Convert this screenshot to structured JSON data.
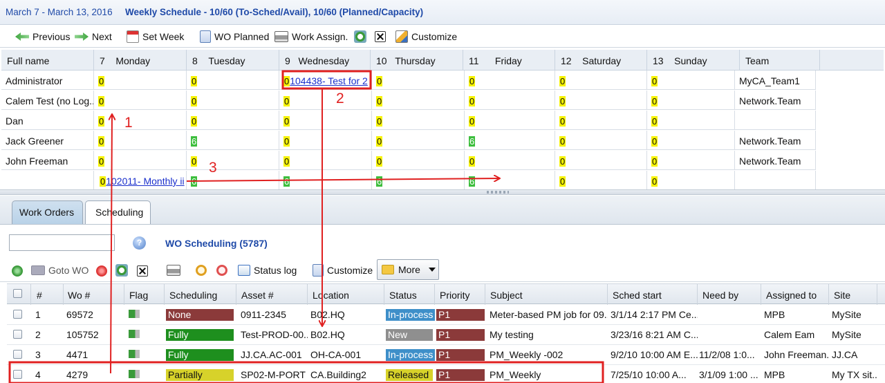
{
  "header": {
    "date_range": "March 7 - March 13, 2016",
    "title": "Weekly Schedule - 10/60 (To-Sched/Avail), 10/60 (Planned/Capacity)"
  },
  "toolbar1": {
    "previous": "Previous",
    "next": "Next",
    "set_week": "Set Week",
    "wo_planned": "WO Planned",
    "work_assign": "Work Assign.",
    "customize": "Customize"
  },
  "schedule": {
    "columns": [
      "Full name",
      "7",
      "Monday",
      "8",
      "Tuesday",
      "9",
      "Wednesday",
      "10",
      "Thursday",
      "11",
      "Friday",
      "12",
      "Saturday",
      "13",
      "Sunday",
      "Team"
    ],
    "rows": [
      {
        "name": "Administrator",
        "mon": "0",
        "tue": "0",
        "wed_num": "0",
        "wed_link": "104438- Test for 2",
        "thu": "0",
        "fri": "0",
        "sat": "0",
        "sun": "0",
        "team": "MyCA_Team1"
      },
      {
        "name": "Calem Test (no Log...",
        "mon": "0",
        "tue": "0",
        "wed": "0",
        "thu": "0",
        "fri": "0",
        "sat": "0",
        "sun": "0",
        "team": "Network.Team"
      },
      {
        "name": "Dan",
        "mon": "0",
        "tue": "0",
        "wed": "0",
        "thu": "0",
        "fri": "0",
        "sat": "0",
        "sun": "0",
        "team": ""
      },
      {
        "name": "Jack Greener",
        "mon": "0",
        "tue": "6",
        "wed": "0",
        "thu": "0",
        "fri": "6",
        "sat": "0",
        "sun": "0",
        "team": "Network.Team"
      },
      {
        "name": "John Freeman",
        "mon": "0",
        "tue": "0",
        "wed": "0",
        "thu": "0",
        "fri": "0",
        "sat": "0",
        "sun": "0",
        "team": "Network.Team"
      },
      {
        "name": "",
        "mon_num": "0",
        "mon_link": "102011- Monthly ii",
        "tue": "6",
        "wed": "6",
        "thu": "6",
        "fri": "6",
        "sat": "0",
        "sun": "0",
        "team": ""
      }
    ]
  },
  "tabs": [
    {
      "label": "Work Orders"
    },
    {
      "label": "Scheduling"
    }
  ],
  "wo_panel": {
    "search_placeholder": "",
    "title": "WO Scheduling (5787)",
    "help": "?"
  },
  "toolbar2": {
    "goto_wo": "Goto WO",
    "status_log": "Status log",
    "customize": "Customize",
    "more": "More"
  },
  "wo_table": {
    "headers": [
      "#",
      "Wo #",
      "Flag",
      "Scheduling",
      "Asset #",
      "Location",
      "Status",
      "Priority",
      "Subject",
      "Sched start",
      "Need by",
      "Assigned to",
      "Site"
    ],
    "rows": [
      {
        "n": "1",
        "wo": "69572",
        "scheduling": "None",
        "sched_color": "#8b3a3a",
        "asset": "0911-2345",
        "location": "B02.HQ",
        "status": "In-process",
        "status_color": "#3e8fc9",
        "priority": "P1",
        "subject": "Meter-based PM job for 09...",
        "sched_start": "3/1/14 2:17 PM Ce...",
        "need_by": "",
        "assigned": "MPB",
        "site": "MySite"
      },
      {
        "n": "2",
        "wo": "105752",
        "scheduling": "Fully",
        "sched_color": "#1e8f1e",
        "asset": "Test-PROD-00...",
        "location": "B02.HQ",
        "status": "New",
        "status_color": "#8f8f8f",
        "priority": "P1",
        "subject": "My testing",
        "sched_start": "3/23/16 8:21 AM C...",
        "need_by": "",
        "assigned": "Calem Eam",
        "site": "MySite"
      },
      {
        "n": "3",
        "wo": "4471",
        "scheduling": "Fully",
        "sched_color": "#1e8f1e",
        "asset": "JJ.CA.AC-001",
        "location": "OH-CA-001",
        "status": "In-process",
        "status_color": "#3e8fc9",
        "priority": "P1",
        "subject": "PM_Weekly -002",
        "sched_start": "9/2/10 10:00 AM E...",
        "need_by": "11/2/08 1:0...",
        "assigned": "John Freeman...",
        "site": "JJ.CA"
      },
      {
        "n": "4",
        "wo": "4279",
        "scheduling": "Partially",
        "sched_color": "#d7d22a",
        "asset": "SP02-M-PORT",
        "location": "CA.Building2",
        "status": "Released",
        "status_color": "#d7d22a",
        "priority": "P1",
        "subject": "PM_Weekly",
        "sched_start": "7/25/10 10:00 A...",
        "need_by": "3/1/09 1:00 ...",
        "assigned": "MPB",
        "site": "My TX sit..."
      }
    ]
  },
  "annotations": [
    "1",
    "2",
    "3"
  ],
  "colors": {
    "accent": "#1f4aa8",
    "annotation": "#e02020",
    "priority": "#8b3a3a",
    "badge_yellow": "#f6f300",
    "badge_green": "#3dbe3d"
  }
}
